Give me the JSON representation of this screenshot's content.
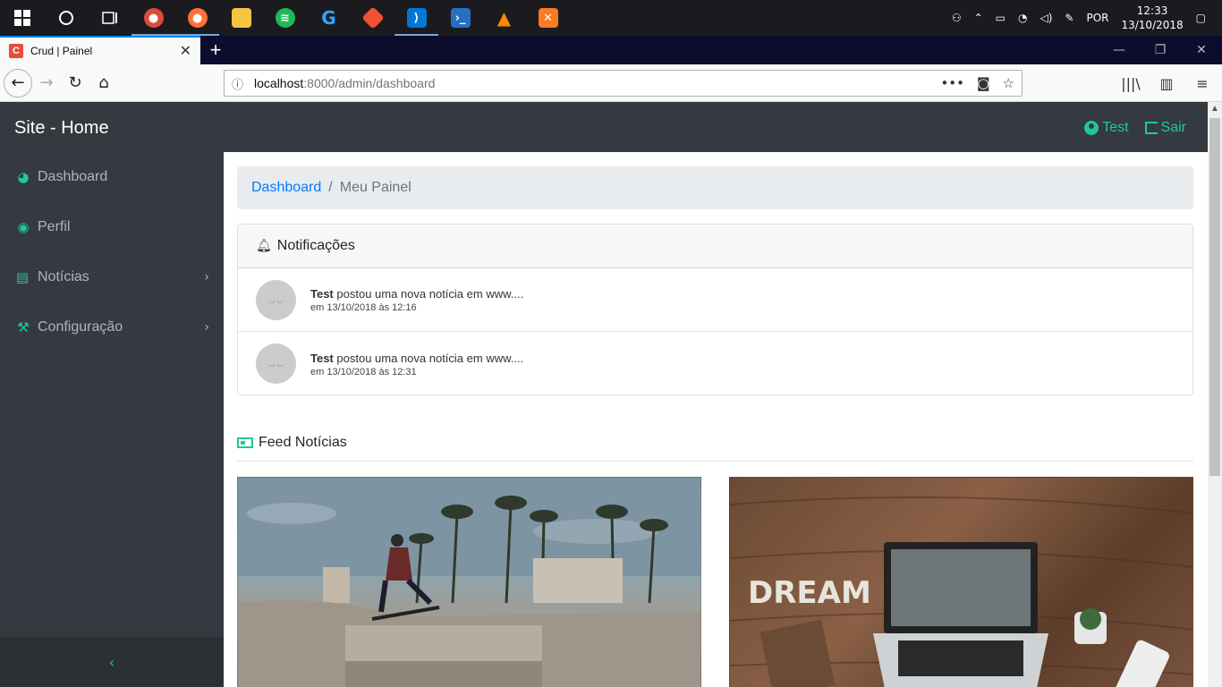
{
  "taskbar": {
    "tray_language": "POR",
    "time": "12:33",
    "date": "13/10/2018"
  },
  "browser": {
    "tab_title": "Crud | Painel",
    "favicon_letter": "C",
    "url_host": "localhost",
    "url_path": ":8000/admin/dashboard"
  },
  "header": {
    "brand": "Site - Home",
    "user_label": "Test",
    "logout_label": "Sair"
  },
  "sidebar": {
    "items": [
      {
        "label": "Dashboard",
        "icon": "dashboard-icon"
      },
      {
        "label": "Perfil",
        "icon": "user-circle-icon"
      },
      {
        "label": "Notícias",
        "icon": "newspaper-icon"
      },
      {
        "label": "Configuração",
        "icon": "wrench-icon"
      }
    ],
    "collapse_icon": "chevron-left-icon"
  },
  "breadcrumb": {
    "home": "Dashboard",
    "separator": "/",
    "current": "Meu Painel"
  },
  "notifications": {
    "title": "Notificações",
    "items": [
      {
        "user": "Test",
        "text": "postou uma nova notícia em www....",
        "time": "em 13/10/2018 às 12:16"
      },
      {
        "user": "Test",
        "text": "postou uma nova notícia em www....",
        "time": "em 13/10/2018 às 12:31"
      }
    ]
  },
  "feed": {
    "title": "Feed Notícias"
  },
  "colors": {
    "accent": "#20c997",
    "sidebar_bg": "#343a40",
    "link": "#007bff"
  }
}
